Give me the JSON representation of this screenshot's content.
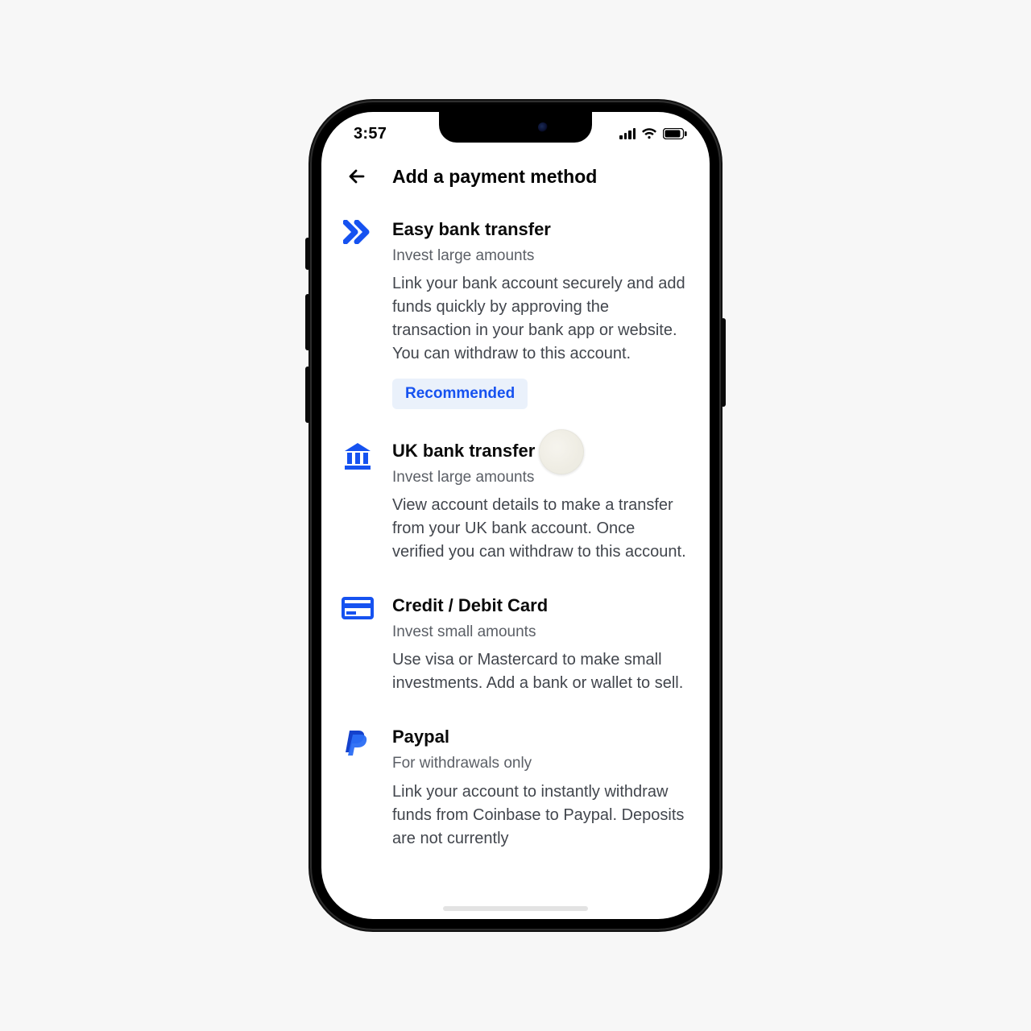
{
  "status": {
    "time": "3:57"
  },
  "header": {
    "title": "Add a payment method"
  },
  "methods": {
    "easy": {
      "title": "Easy bank transfer",
      "subtitle": "Invest large amounts",
      "desc": "Link your bank account securely and add funds quickly by approving the transaction in your bank app or website. You can withdraw to this account.",
      "badge": "Recommended"
    },
    "uk": {
      "title": "UK bank transfer",
      "subtitle": "Invest large amounts",
      "desc": "View account details to make a transfer from your UK bank account. Once verified you can withdraw to this account."
    },
    "card": {
      "title": "Credit / Debit Card",
      "subtitle": "Invest small amounts",
      "desc": "Use visa or Mastercard to make small investments. Add a bank or wallet to sell."
    },
    "paypal": {
      "title": "Paypal",
      "subtitle": "For withdrawals only",
      "desc": "Link your account to instantly withdraw funds from Coinbase to Paypal. Deposits are not currently"
    }
  },
  "colors": {
    "accent": "#1652F0"
  }
}
